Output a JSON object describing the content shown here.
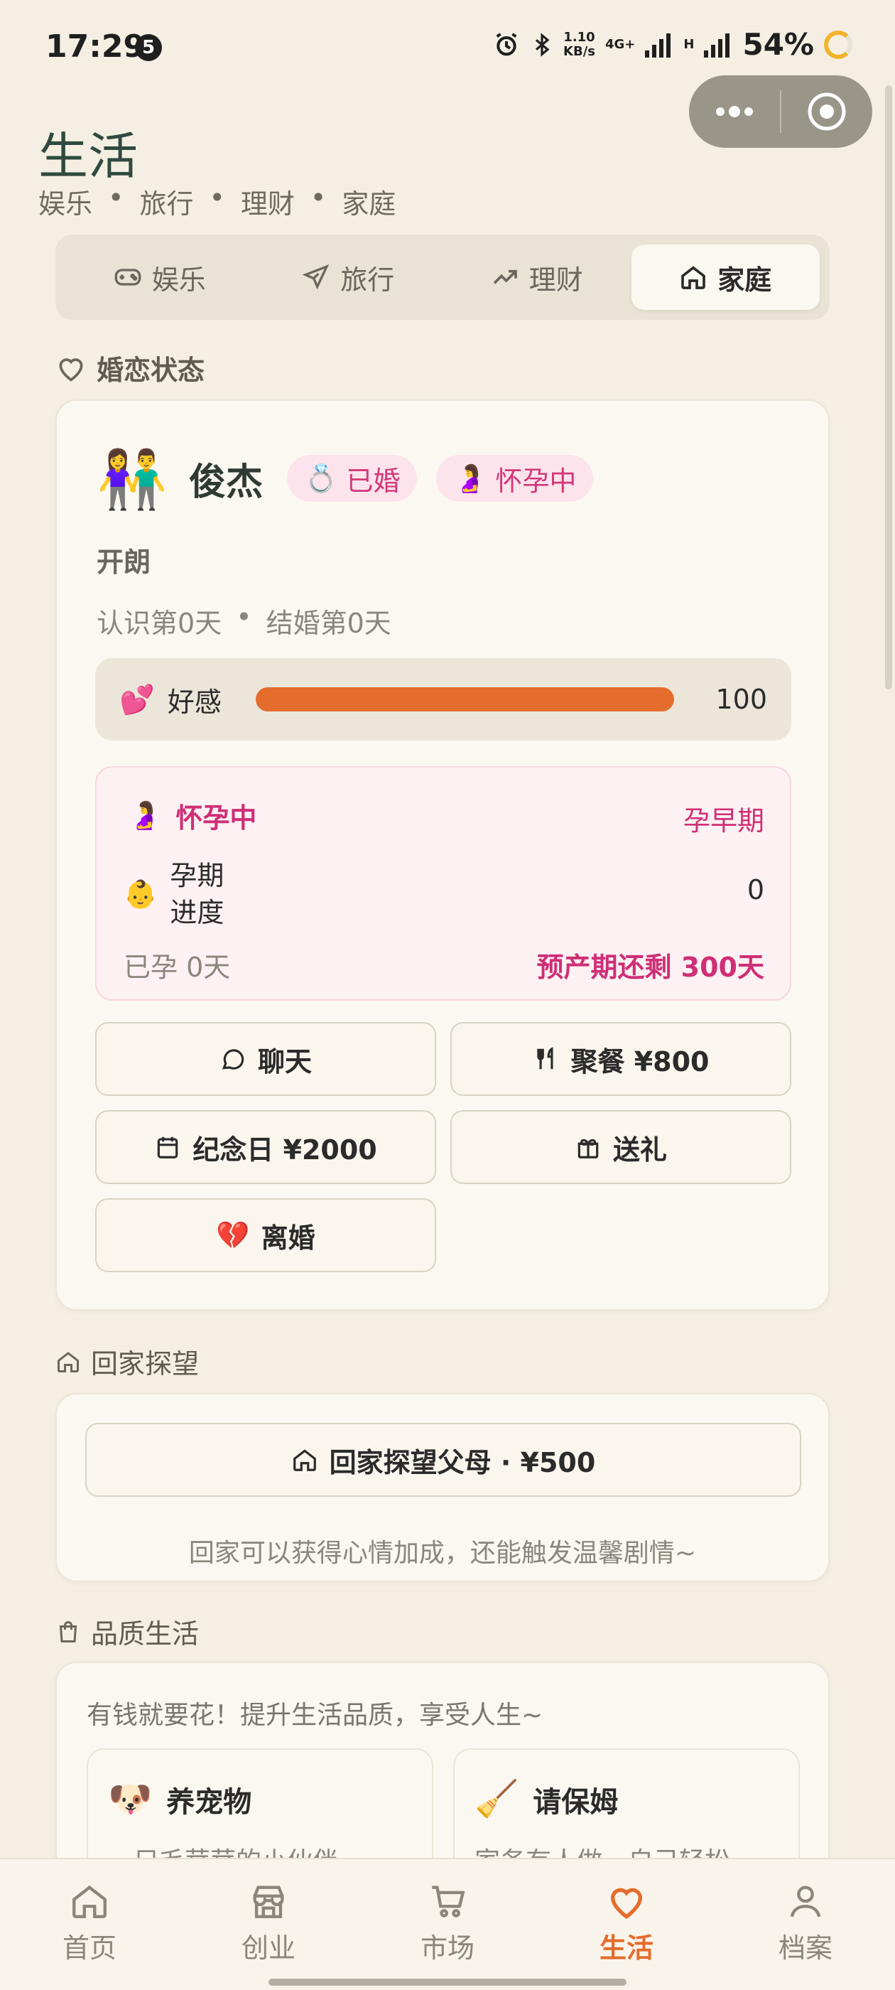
{
  "status_bar": {
    "time": "17:29",
    "badge": "5",
    "speed_value": "1.10",
    "speed_unit": "KB/s",
    "network1": "4G+",
    "network2": "H",
    "battery": "54%"
  },
  "header": {
    "title": "生活",
    "subtitle": [
      "娱乐",
      "旅行",
      "理财",
      "家庭"
    ]
  },
  "tabs": [
    {
      "label": "娱乐",
      "icon": "gamepad-icon",
      "active": false
    },
    {
      "label": "旅行",
      "icon": "plane-icon",
      "active": false
    },
    {
      "label": "理财",
      "icon": "trending-up-icon",
      "active": false
    },
    {
      "label": "家庭",
      "icon": "home-icon",
      "active": true
    }
  ],
  "relationship": {
    "section_title": "婚恋状态",
    "avatar": "👫",
    "name": "俊杰",
    "status_married": "已婚",
    "status_married_emoji": "💍",
    "status_pregnant": "怀孕中",
    "status_pregnant_emoji": "🤰",
    "trait": "开朗",
    "days_known": "认识第0天",
    "days_married": "结婚第0天",
    "affection_emoji": "💕",
    "affection_label": "好感",
    "affection_value": "100",
    "affection_max": 100,
    "pregnancy": {
      "emoji": "🤰",
      "title": "怀孕中",
      "stage": "孕早期",
      "progress_emoji": "👶",
      "progress_label_1": "孕期",
      "progress_label_2": "进度",
      "progress_value": "0",
      "days_pregnant": "已孕 0天",
      "due": "预产期还剩 300天"
    },
    "actions": [
      {
        "label": "聊天",
        "icon": "chat-icon"
      },
      {
        "label": "聚餐 ¥800",
        "icon": "utensils-icon"
      },
      {
        "label": "纪念日 ¥2000",
        "icon": "calendar-icon"
      },
      {
        "label": "送礼",
        "icon": "gift-icon"
      },
      {
        "label": "离婚",
        "icon": "broken-heart-icon",
        "emoji": "💔"
      }
    ]
  },
  "visit": {
    "section_title": "回家探望",
    "button_label": "回家探望父母 · ¥500",
    "note": "回家可以获得心情加成，还能触发温馨剧情~"
  },
  "quality": {
    "section_title": "品质生活",
    "intro": "有钱就要花！提升生活品质，享受人生~",
    "items": [
      {
        "emoji": "🐶",
        "title": "养宠物",
        "desc": "一只毛茸茸的小伙伴"
      },
      {
        "emoji": "🧹",
        "title": "请保姆",
        "desc": "家务有人做，自己轻松"
      }
    ]
  },
  "bottom_nav": [
    {
      "label": "首页",
      "icon": "home-icon",
      "active": false
    },
    {
      "label": "创业",
      "icon": "store-icon",
      "active": false
    },
    {
      "label": "市场",
      "icon": "cart-icon",
      "active": false
    },
    {
      "label": "生活",
      "icon": "heart-icon",
      "active": true
    },
    {
      "label": "档案",
      "icon": "user-icon",
      "active": false
    }
  ],
  "colors": {
    "background": "#f4efe2",
    "accent": "#e46c2d",
    "pink": "#cf2f76",
    "title_green": "#2f4a3e"
  }
}
